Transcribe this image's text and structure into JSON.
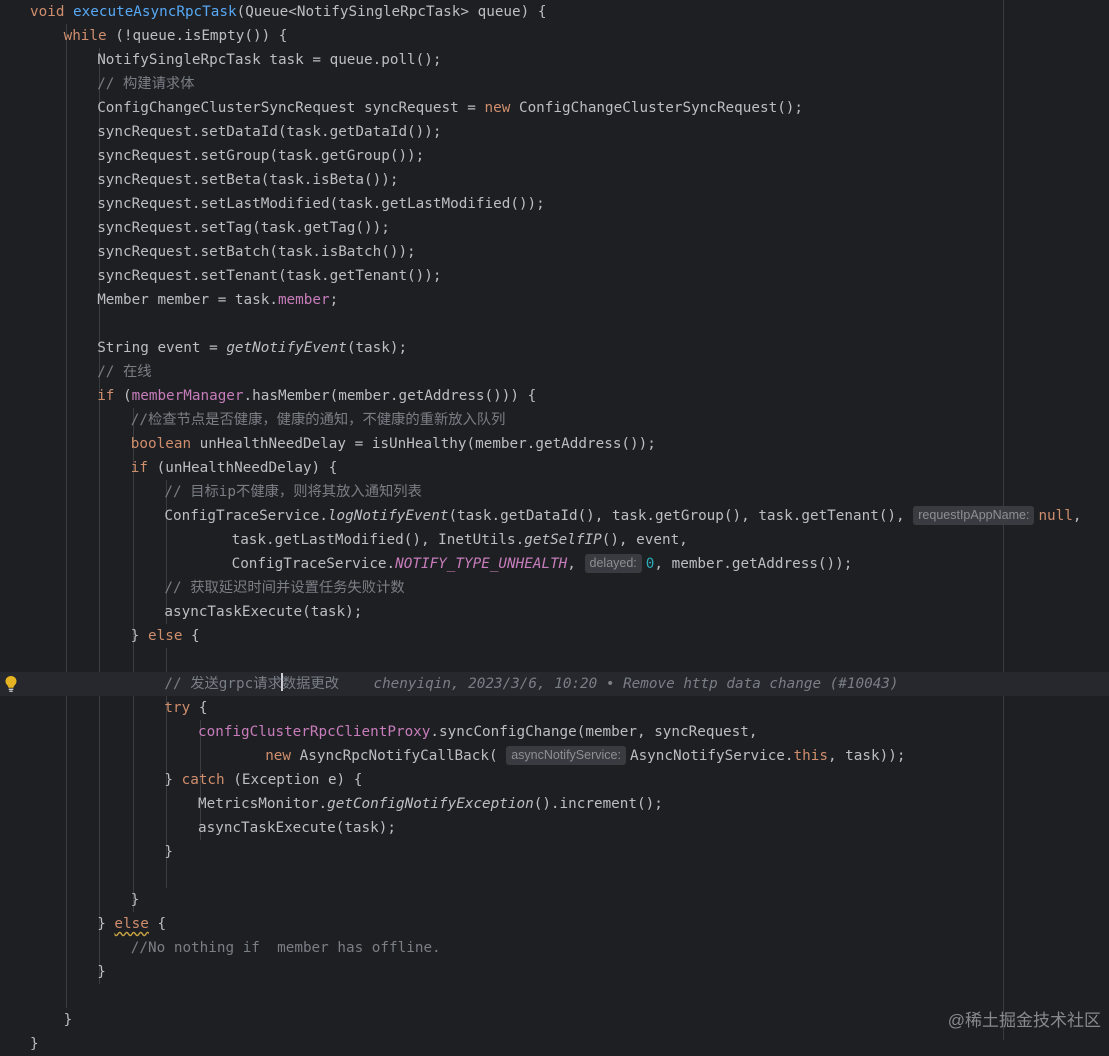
{
  "editor": {
    "caret_line": 28,
    "lines": [
      {
        "indent": 0,
        "tokens": [
          {
            "t": "void ",
            "c": "kw"
          },
          {
            "t": "executeAsyncRpcTask",
            "c": "fn"
          },
          {
            "t": "(Queue<NotifySingleRpcTask> queue) {"
          }
        ]
      },
      {
        "indent": 1,
        "tokens": [
          {
            "t": "while",
            "c": "kw"
          },
          {
            "t": " (!queue.isEmpty()) {"
          }
        ]
      },
      {
        "indent": 2,
        "tokens": [
          {
            "t": "NotifySingleRpcTask task = queue.poll();"
          }
        ]
      },
      {
        "indent": 2,
        "tokens": [
          {
            "t": "// 构建请求体",
            "c": "cm"
          }
        ]
      },
      {
        "indent": 2,
        "tokens": [
          {
            "t": "ConfigChangeClusterSyncRequest syncRequest = "
          },
          {
            "t": "new",
            "c": "kw"
          },
          {
            "t": " ConfigChangeClusterSyncRequest();"
          }
        ]
      },
      {
        "indent": 2,
        "tokens": [
          {
            "t": "syncRequest.setDataId(task.getDataId());"
          }
        ]
      },
      {
        "indent": 2,
        "tokens": [
          {
            "t": "syncRequest.setGroup(task.getGroup());"
          }
        ]
      },
      {
        "indent": 2,
        "tokens": [
          {
            "t": "syncRequest.setBeta(task.isBeta());"
          }
        ]
      },
      {
        "indent": 2,
        "tokens": [
          {
            "t": "syncRequest.setLastModified(task.getLastModified());"
          }
        ]
      },
      {
        "indent": 2,
        "tokens": [
          {
            "t": "syncRequest.setTag(task.getTag());"
          }
        ]
      },
      {
        "indent": 2,
        "tokens": [
          {
            "t": "syncRequest.setBatch(task.isBatch());"
          }
        ]
      },
      {
        "indent": 2,
        "tokens": [
          {
            "t": "syncRequest.setTenant(task.getTenant());"
          }
        ]
      },
      {
        "indent": 2,
        "tokens": [
          {
            "t": "Member member = task."
          },
          {
            "t": "member",
            "c": "fld"
          },
          {
            "t": ";"
          }
        ]
      },
      {
        "indent": 0,
        "tokens": []
      },
      {
        "indent": 2,
        "tokens": [
          {
            "t": "String event = "
          },
          {
            "t": "getNotifyEvent",
            "c": "it"
          },
          {
            "t": "(task);"
          }
        ]
      },
      {
        "indent": 2,
        "tokens": [
          {
            "t": "// 在线",
            "c": "cm"
          }
        ]
      },
      {
        "indent": 2,
        "tokens": [
          {
            "t": "if",
            "c": "kw"
          },
          {
            "t": " ("
          },
          {
            "t": "memberManager",
            "c": "fld"
          },
          {
            "t": ".hasMember(member.getAddress())) {"
          }
        ]
      },
      {
        "indent": 3,
        "tokens": [
          {
            "t": "//检查节点是否健康，健康的通知，不健康的重新放入队列",
            "c": "cm"
          }
        ]
      },
      {
        "indent": 3,
        "tokens": [
          {
            "t": "boolean",
            "c": "kw"
          },
          {
            "t": " unHealthNeedDelay = isUnHealthy(member.getAddress());"
          }
        ]
      },
      {
        "indent": 3,
        "tokens": [
          {
            "t": "if",
            "c": "kw"
          },
          {
            "t": " (unHealthNeedDelay) {"
          }
        ]
      },
      {
        "indent": 4,
        "tokens": [
          {
            "t": "// 目标ip不健康，则将其放入通知列表",
            "c": "cm"
          }
        ]
      },
      {
        "indent": 4,
        "tokens": [
          {
            "t": "ConfigTraceService."
          },
          {
            "t": "logNotifyEvent",
            "c": "it"
          },
          {
            "t": "(task.getDataId(), task.getGroup(), task.getTenant(), "
          },
          {
            "t": "requestIpAppName:",
            "c": "hint"
          },
          {
            "t": "null",
            "c": "kw"
          },
          {
            "t": ","
          }
        ]
      },
      {
        "indent": 6,
        "tokens": [
          {
            "t": "task.getLastModified(), InetUtils."
          },
          {
            "t": "getSelfIP",
            "c": "it"
          },
          {
            "t": "(), event,"
          }
        ]
      },
      {
        "indent": 6,
        "tokens": [
          {
            "t": "ConfigTraceService."
          },
          {
            "t": "NOTIFY_TYPE_UNHEALTH",
            "c": "stat"
          },
          {
            "t": ", "
          },
          {
            "t": "delayed:",
            "c": "hint"
          },
          {
            "t": "0",
            "c": "num"
          },
          {
            "t": ", member.getAddress());"
          }
        ]
      },
      {
        "indent": 4,
        "tokens": [
          {
            "t": "// 获取延迟时间并设置任务失败计数",
            "c": "cm"
          }
        ]
      },
      {
        "indent": 4,
        "tokens": [
          {
            "t": "asyncTaskExecute(task);"
          }
        ]
      },
      {
        "indent": 3,
        "tokens": [
          {
            "t": "} "
          },
          {
            "t": "else",
            "c": "kw"
          },
          {
            "t": " {"
          }
        ]
      },
      {
        "indent": 0,
        "tokens": []
      },
      {
        "indent": 4,
        "tokens": [
          {
            "t": "// 发送grpc请求",
            "c": "cm"
          },
          {
            "t": "",
            "c": "caret"
          },
          {
            "t": "数据更改",
            "c": "cm"
          },
          {
            "t": "    chenyiqin, 2023/3/6, 10:20 • Remove http data change (#10043)",
            "c": "ann"
          }
        ]
      },
      {
        "indent": 4,
        "tokens": [
          {
            "t": "try",
            "c": "kw"
          },
          {
            "t": " {"
          }
        ]
      },
      {
        "indent": 5,
        "tokens": [
          {
            "t": "configClusterRpcClientProxy",
            "c": "fld"
          },
          {
            "t": ".syncConfigChange(member, syncRequest,"
          }
        ]
      },
      {
        "indent": 7,
        "tokens": [
          {
            "t": "new",
            "c": "kw"
          },
          {
            "t": " AsyncRpcNotifyCallBack( "
          },
          {
            "t": "asyncNotifyService:",
            "c": "hint"
          },
          {
            "t": "AsyncNotifyService."
          },
          {
            "t": "this",
            "c": "kw"
          },
          {
            "t": ", task));"
          }
        ]
      },
      {
        "indent": 4,
        "tokens": [
          {
            "t": "} "
          },
          {
            "t": "catch",
            "c": "kw"
          },
          {
            "t": " (Exception e) {"
          }
        ]
      },
      {
        "indent": 5,
        "tokens": [
          {
            "t": "MetricsMonitor."
          },
          {
            "t": "getConfigNotifyException",
            "c": "it"
          },
          {
            "t": "().increment();"
          }
        ]
      },
      {
        "indent": 5,
        "tokens": [
          {
            "t": "asyncTaskExecute(task);"
          }
        ]
      },
      {
        "indent": 4,
        "tokens": [
          {
            "t": "}"
          }
        ]
      },
      {
        "indent": 0,
        "tokens": []
      },
      {
        "indent": 3,
        "tokens": [
          {
            "t": "}"
          }
        ]
      },
      {
        "indent": 2,
        "tokens": [
          {
            "t": "} "
          },
          {
            "t": "else",
            "c": "kw warn"
          },
          {
            "t": " {"
          }
        ]
      },
      {
        "indent": 3,
        "tokens": [
          {
            "t": "//No nothing if  member has offline.",
            "c": "cm"
          }
        ]
      },
      {
        "indent": 2,
        "tokens": [
          {
            "t": "}"
          }
        ]
      },
      {
        "indent": 0,
        "tokens": []
      },
      {
        "indent": 1,
        "tokens": [
          {
            "t": "}"
          }
        ]
      },
      {
        "indent": 0,
        "tokens": [
          {
            "t": "}"
          }
        ]
      }
    ]
  },
  "gutter": {
    "intention_icon": "lightbulb-icon",
    "icon_color": "#e6b422"
  },
  "watermark": {
    "text": "@稀土掘金技术社区"
  },
  "colors": {
    "background": "#1e1f22",
    "keyword": "#cf8e6d",
    "function": "#56a8f5",
    "field": "#c77dbb",
    "comment": "#7a7e85",
    "number": "#2aacb8"
  }
}
